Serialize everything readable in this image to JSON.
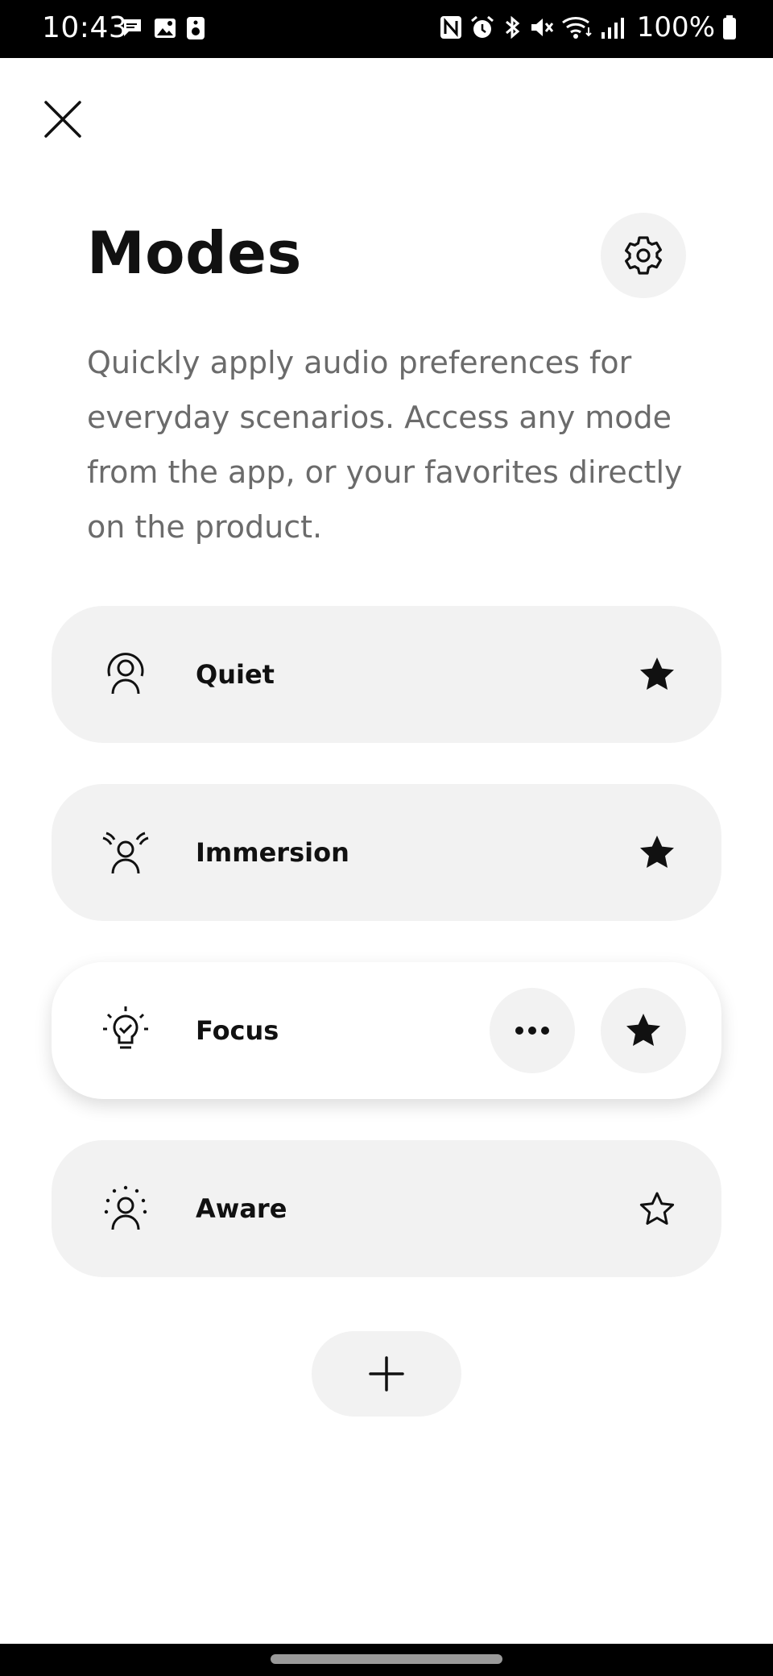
{
  "status_bar": {
    "time": "10:43",
    "battery": "100%",
    "left_icons": [
      "message-icon",
      "image-icon",
      "speaker-icon"
    ],
    "right_icons": [
      "nfc-icon",
      "alarm-icon",
      "bluetooth-icon",
      "mute-icon",
      "wifi-icon",
      "signal-icon",
      "battery-icon"
    ]
  },
  "header": {
    "title": "Modes",
    "description": "Quickly apply audio preferences for everyday scenarios. Access any mode from the app, or your favorites directly on the product."
  },
  "modes": [
    {
      "label": "Quiet",
      "icon": "quiet-person-icon",
      "favorite": true,
      "selected": false
    },
    {
      "label": "Immersion",
      "icon": "immersion-person-icon",
      "favorite": true,
      "selected": false
    },
    {
      "label": "Focus",
      "icon": "lightbulb-check-icon",
      "favorite": true,
      "selected": true
    },
    {
      "label": "Aware",
      "icon": "aware-person-icon",
      "favorite": false,
      "selected": false
    }
  ],
  "colors": {
    "card_bg": "#f2f2f2",
    "text": "#111111",
    "description": "#6b6b6b"
  }
}
